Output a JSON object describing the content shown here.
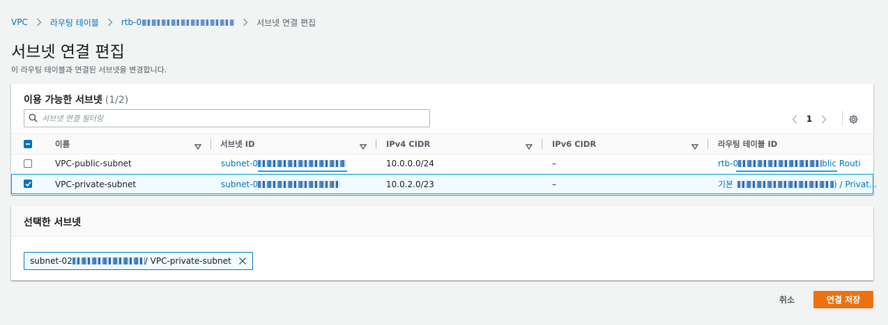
{
  "breadcrumb": {
    "vpc": "VPC",
    "route_tables": "라우팅 테이블",
    "route_table_id": "rtb-0",
    "current": "서브넷 연결 편집"
  },
  "page": {
    "title": "서브넷 연결 편집",
    "description": "이 라우팅 테이블과 연결된 서브넷을 변경합니다."
  },
  "available": {
    "title": "이용 가능한 서브넷",
    "count": "(1/2)",
    "filter_placeholder": "서브넷 연결 필터링",
    "page_number": "1",
    "columns": [
      "이름",
      "서브넷 ID",
      "IPv4 CIDR",
      "IPv6 CIDR",
      "라우팅 테이블 ID"
    ],
    "rows": [
      {
        "checked": false,
        "name": "VPC-public-subnet",
        "subnet_id": "subnet-0",
        "ipv4": "10.0.0.0/24",
        "ipv6": "–",
        "route_table_prefix": "rtb-0",
        "route_table_suffix": "blic Routi"
      },
      {
        "checked": true,
        "name": "VPC-private-subnet",
        "subnet_id": "subnet-0",
        "ipv4": "10.0.2.0/23",
        "ipv6": "–",
        "route_table_prefix": "기본",
        "route_table_suffix": ") / Privat..."
      }
    ]
  },
  "selected": {
    "title": "선택한 서브넷",
    "token_prefix": "subnet-02",
    "token_suffix": "/ VPC-private-subnet"
  },
  "actions": {
    "cancel": "취소",
    "save": "연결 저장"
  },
  "colors": {
    "link": "#0073bb",
    "primary_button": "#ec7211",
    "selected_row_bg": "#f1faff",
    "selected_row_border": "#00a1c9"
  }
}
